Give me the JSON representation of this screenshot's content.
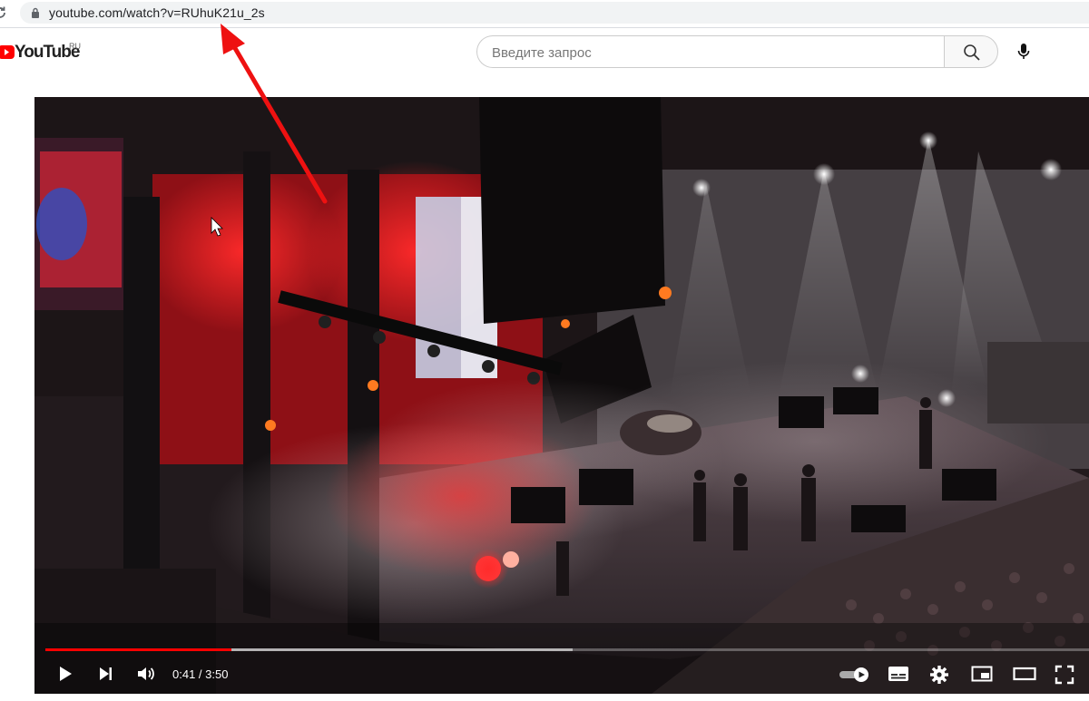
{
  "browser": {
    "url": "youtube.com/watch?v=RUhuK21u_2s"
  },
  "header": {
    "logo_text": "YouTube",
    "region": "RU",
    "search_placeholder": "Введите запрос"
  },
  "player": {
    "current_time": "0:41",
    "duration": "3:50",
    "time_display": "0:41 / 3:50",
    "progress_fraction": 0.178,
    "buffered_fraction": 0.505,
    "autoplay": "on"
  },
  "colors": {
    "youtube_red": "#ff0000",
    "annotation_arrow": "#ee1111"
  }
}
